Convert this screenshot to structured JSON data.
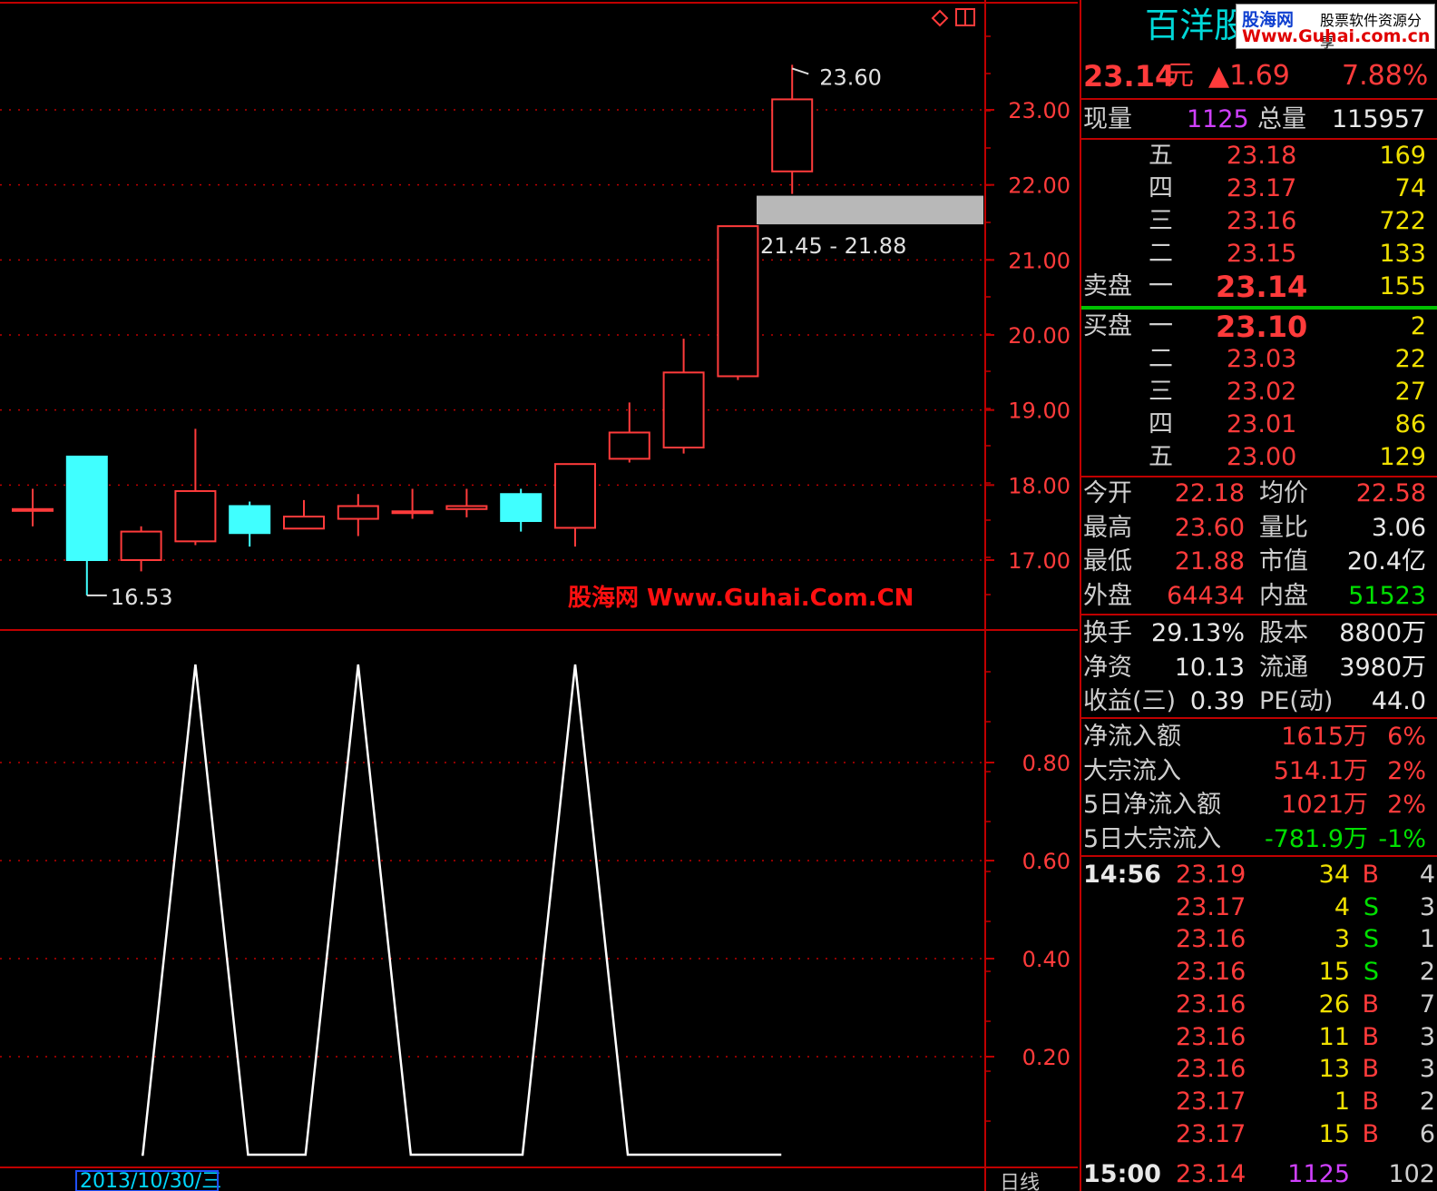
{
  "stock": {
    "name": "百洋股份",
    "price": "23.14",
    "unit": "元",
    "change": "▲1.69",
    "pct": "7.88%"
  },
  "volume": {
    "now_label": "现量",
    "now": "1125",
    "total_label": "总量",
    "total": "115957"
  },
  "sell_label": "卖盘",
  "buy_label": "买盘",
  "asks": [
    {
      "level": "五",
      "price": "23.18",
      "vol": "169"
    },
    {
      "level": "四",
      "price": "23.17",
      "vol": "74"
    },
    {
      "level": "三",
      "price": "23.16",
      "vol": "722"
    },
    {
      "level": "二",
      "price": "23.15",
      "vol": "133"
    },
    {
      "level": "一",
      "price": "23.14",
      "vol": "155"
    }
  ],
  "bids": [
    {
      "level": "一",
      "price": "23.10",
      "vol": "2"
    },
    {
      "level": "二",
      "price": "23.03",
      "vol": "22"
    },
    {
      "level": "三",
      "price": "23.02",
      "vol": "27"
    },
    {
      "level": "四",
      "price": "23.01",
      "vol": "86"
    },
    {
      "level": "五",
      "price": "23.00",
      "vol": "129"
    }
  ],
  "stats1": [
    {
      "l1": "今开",
      "v1": "22.18",
      "l2": "均价",
      "v2": "22.58"
    },
    {
      "l1": "最高",
      "v1": "23.60",
      "l2": "量比",
      "v2": "3.06"
    },
    {
      "l1": "最低",
      "v1": "21.88",
      "l2": "市值",
      "v2": "20.4亿"
    },
    {
      "l1": "外盘",
      "v1": "64434",
      "l2": "内盘",
      "v2": "51523"
    }
  ],
  "stats2": [
    {
      "l1": "换手",
      "v1": "29.13%",
      "l2": "股本",
      "v2": "8800万"
    },
    {
      "l1": "净资",
      "v1": "10.13",
      "l2": "流通",
      "v2": "3980万"
    },
    {
      "l1": "收益(三)",
      "v1": "0.39",
      "l2": "PE(动)",
      "v2": "44.0"
    }
  ],
  "flows": [
    {
      "label": "净流入额",
      "value": "1615万",
      "pct": "6%"
    },
    {
      "label": "大宗流入",
      "value": "514.1万",
      "pct": "2%"
    },
    {
      "label": "5日净流入额",
      "value": "1021万",
      "pct": "2%"
    },
    {
      "label": "5日大宗流入",
      "value": "-781.9万",
      "pct": "-1%"
    }
  ],
  "ticks": [
    {
      "time": "14:56",
      "price": "23.19",
      "vol": "34",
      "side": "B",
      "n": "4"
    },
    {
      "time": "",
      "price": "23.17",
      "vol": "4",
      "side": "S",
      "n": "3"
    },
    {
      "time": "",
      "price": "23.16",
      "vol": "3",
      "side": "S",
      "n": "1"
    },
    {
      "time": "",
      "price": "23.16",
      "vol": "15",
      "side": "S",
      "n": "2"
    },
    {
      "time": "",
      "price": "23.16",
      "vol": "26",
      "side": "B",
      "n": "7"
    },
    {
      "time": "",
      "price": "23.16",
      "vol": "11",
      "side": "B",
      "n": "3"
    },
    {
      "time": "",
      "price": "23.16",
      "vol": "13",
      "side": "B",
      "n": "3"
    },
    {
      "time": "",
      "price": "23.17",
      "vol": "1",
      "side": "B",
      "n": "2"
    },
    {
      "time": "",
      "price": "23.17",
      "vol": "15",
      "side": "B",
      "n": "6"
    },
    {
      "time": "15:00",
      "price": "23.14",
      "vol": "1125",
      "side": "",
      "n": "102"
    }
  ],
  "watermark": {
    "top_brand": "股海网",
    "top_sub": "股票软件资源分享",
    "top_url": "Www.Guhai.com.cn",
    "center": "股海网 Www.Guhai.Com.CN"
  },
  "bottom_bar": {
    "date": "2013/10/30/三",
    "period": "日线"
  },
  "colors": {
    "up": "#ff3b3b",
    "down": "#40ffff",
    "grid": "#c00000",
    "band": "#b8b8b8"
  },
  "chart_data": [
    {
      "type": "candlestick",
      "y_ticks": [
        "23.00",
        "22.00",
        "21.00",
        "20.00",
        "19.00",
        "18.00",
        "17.00"
      ],
      "ylim": [
        16.2,
        24.3
      ],
      "annotations": {
        "high_label": "23.60",
        "low_label": "16.53",
        "band_label": "21.45 - 21.88",
        "band_low": 21.45,
        "band_high": 21.88
      },
      "candles": [
        {
          "o": 17.68,
          "h": 17.95,
          "l": 17.45,
          "c": 17.68
        },
        {
          "o": 18.38,
          "h": 18.38,
          "l": 16.53,
          "c": 17.0
        },
        {
          "o": 17.0,
          "h": 17.45,
          "l": 16.85,
          "c": 17.38
        },
        {
          "o": 17.25,
          "h": 18.75,
          "l": 17.2,
          "c": 17.92
        },
        {
          "o": 17.72,
          "h": 17.78,
          "l": 17.18,
          "c": 17.36
        },
        {
          "o": 17.42,
          "h": 17.8,
          "l": 17.42,
          "c": 17.58
        },
        {
          "o": 17.55,
          "h": 17.88,
          "l": 17.32,
          "c": 17.72
        },
        {
          "o": 17.63,
          "h": 17.95,
          "l": 17.55,
          "c": 17.65
        },
        {
          "o": 17.68,
          "h": 17.95,
          "l": 17.57,
          "c": 17.72
        },
        {
          "o": 17.88,
          "h": 17.95,
          "l": 17.38,
          "c": 17.52
        },
        {
          "o": 17.43,
          "h": 18.28,
          "l": 17.18,
          "c": 18.28
        },
        {
          "o": 18.35,
          "h": 19.1,
          "l": 18.3,
          "c": 18.7
        },
        {
          "o": 18.5,
          "h": 19.95,
          "l": 18.42,
          "c": 19.5
        },
        {
          "o": 19.45,
          "h": 21.45,
          "l": 19.4,
          "c": 21.45
        },
        {
          "o": 22.18,
          "h": 23.6,
          "l": 21.88,
          "c": 23.14
        }
      ]
    },
    {
      "type": "line",
      "y_ticks": [
        "0.80",
        "0.60",
        "0.40",
        "0.20"
      ],
      "ylim": [
        0,
        1
      ],
      "values": [
        0,
        0,
        0,
        1,
        0,
        0,
        1,
        0,
        0,
        0,
        1,
        0,
        0,
        0
      ]
    }
  ]
}
